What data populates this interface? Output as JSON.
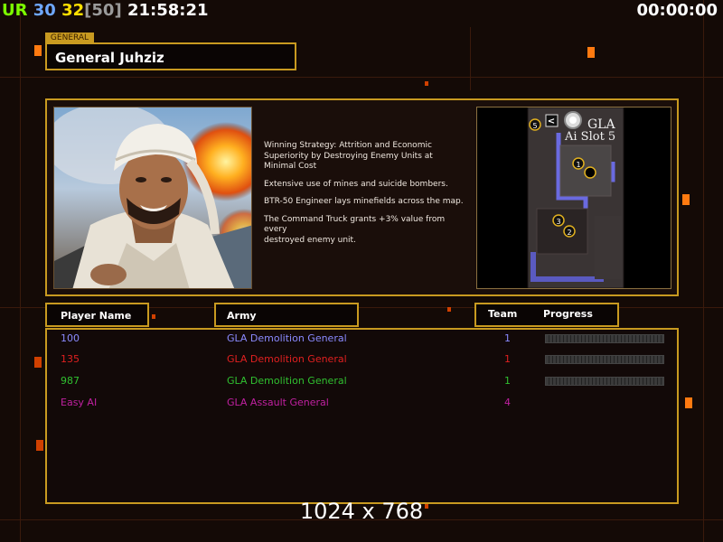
{
  "hud": {
    "ur_label": "UR",
    "ur_color": "#7CFC00",
    "fps1": "30",
    "fps1_color": "#6fa8ff",
    "fps2": "32",
    "fps2_color": "#ffe000",
    "fps_cap": "[50]",
    "fps_cap_color": "#9a9a9a",
    "clock": "21:58:21",
    "timer": "00:00:00"
  },
  "general": {
    "tag": "GENERAL",
    "name": "General Juhziz"
  },
  "description": [
    "Winning Strategy: Attrition and Economic\n Superiority by Destroying Enemy Units at\n Minimal Cost",
    "Extensive use of mines and suicide bombers.",
    "BTR-50 Engineer lays minefields across the map.",
    "The Command Truck grants +3% value from every\n destroyed enemy unit."
  ],
  "minimap": {
    "title_line1": "GLA",
    "title_line2": "Ai Slot 5",
    "back_glyph": "<",
    "markers": [
      "5",
      "1",
      "3",
      "2"
    ]
  },
  "columns": {
    "player_name": "Player Name",
    "army": "Army",
    "team": "Team",
    "progress": "Progress"
  },
  "players": [
    {
      "name": "100",
      "army": "GLA Demolition General",
      "team": "1",
      "color": "#8a8aff",
      "progress": 0
    },
    {
      "name": "135",
      "army": "GLA Demolition General",
      "team": "1",
      "color": "#e02020",
      "progress": 0
    },
    {
      "name": "987",
      "army": "GLA Demolition General",
      "team": "1",
      "color": "#30c030",
      "progress": 0
    },
    {
      "name": "Easy AI",
      "army": "GLA Assault General",
      "team": "4",
      "color": "#c020a0",
      "progress": null
    }
  ],
  "resolution": "1024 x 768"
}
